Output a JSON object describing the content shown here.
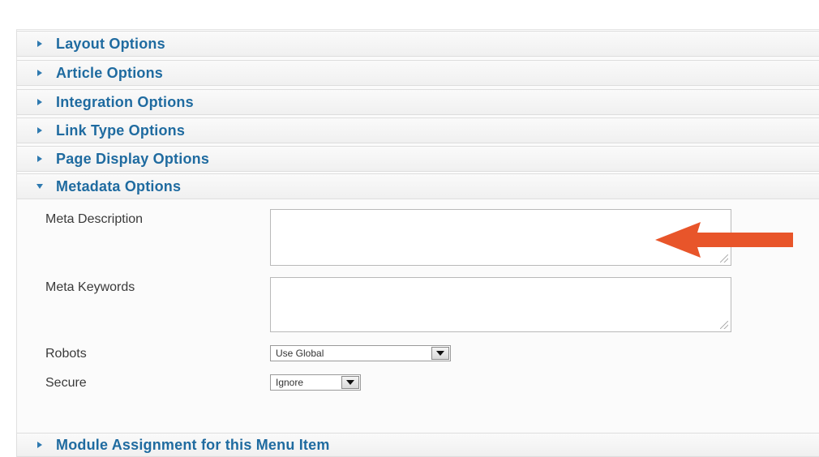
{
  "sections": [
    {
      "label": "Layout Options",
      "expanded": false
    },
    {
      "label": "Article Options",
      "expanded": false
    },
    {
      "label": "Integration Options",
      "expanded": false
    },
    {
      "label": "Link Type Options",
      "expanded": false
    },
    {
      "label": "Page Display Options",
      "expanded": false
    },
    {
      "label": "Metadata Options",
      "expanded": true
    },
    {
      "label": "Module Assignment for this Menu Item",
      "expanded": false
    }
  ],
  "metadata": {
    "meta_description_label": "Meta Description",
    "meta_description_value": "",
    "meta_keywords_label": "Meta Keywords",
    "meta_keywords_value": "",
    "robots_label": "Robots",
    "robots_value": "Use Global",
    "secure_label": "Secure",
    "secure_value": "Ignore"
  },
  "annotation": {
    "arrow_color": "#e8552a",
    "icon": "left-arrow-icon"
  },
  "colors": {
    "section_title": "#1f6ba0",
    "toggle_icon": "#2f7ab0"
  }
}
